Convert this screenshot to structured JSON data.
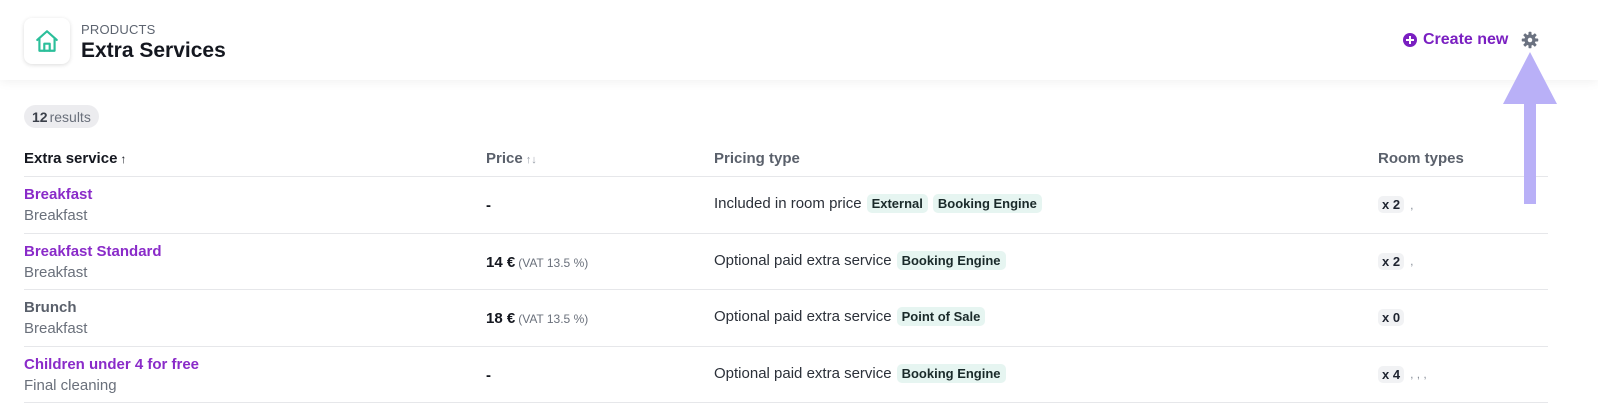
{
  "header": {
    "eyebrow": "PRODUCTS",
    "title": "Extra Services",
    "create_new_label": "Create new"
  },
  "colors": {
    "accent": "#7a1fc1",
    "home_icon": "#2bbf9a",
    "tag_bg": "#e6f5f1",
    "annotation_arrow": "#b9b0f7"
  },
  "icons": {
    "home": "home-icon",
    "create": "plus-circle-icon",
    "settings": "gear-icon",
    "annotation": "arrow-up-icon"
  },
  "results": {
    "count": "12",
    "label": "results"
  },
  "columns": {
    "service": "Extra service",
    "service_sort": "↑",
    "price": "Price",
    "price_sort": "↑↓",
    "pricing_type": "Pricing type",
    "room_types": "Room types"
  },
  "rows": [
    {
      "name": "Breakfast",
      "category": "Breakfast",
      "price": "-",
      "vat": "",
      "pricing_type": "Included in room price",
      "tags": [
        "External",
        "Booking Engine"
      ],
      "room_count": "x 2",
      "room_sep": ","
    },
    {
      "name": "Breakfast Standard",
      "category": "Breakfast",
      "price": "14 €",
      "vat": "(VAT 13.5 %)",
      "pricing_type": "Optional paid extra service",
      "tags": [
        "Booking Engine"
      ],
      "room_count": "x 2",
      "room_sep": ","
    },
    {
      "name": "Brunch",
      "category": "Breakfast",
      "price": "18 €",
      "vat": "(VAT 13.5 %)",
      "pricing_type": "Optional paid extra service",
      "tags": [
        "Point of Sale"
      ],
      "room_count": "x 0",
      "room_sep": ""
    },
    {
      "name": "Children under 4 for free",
      "category": "Final cleaning",
      "price": "-",
      "vat": "",
      "pricing_type": "Optional paid extra service",
      "tags": [
        "Booking Engine"
      ],
      "room_count": "x 4",
      "room_sep": ", , ,"
    }
  ]
}
